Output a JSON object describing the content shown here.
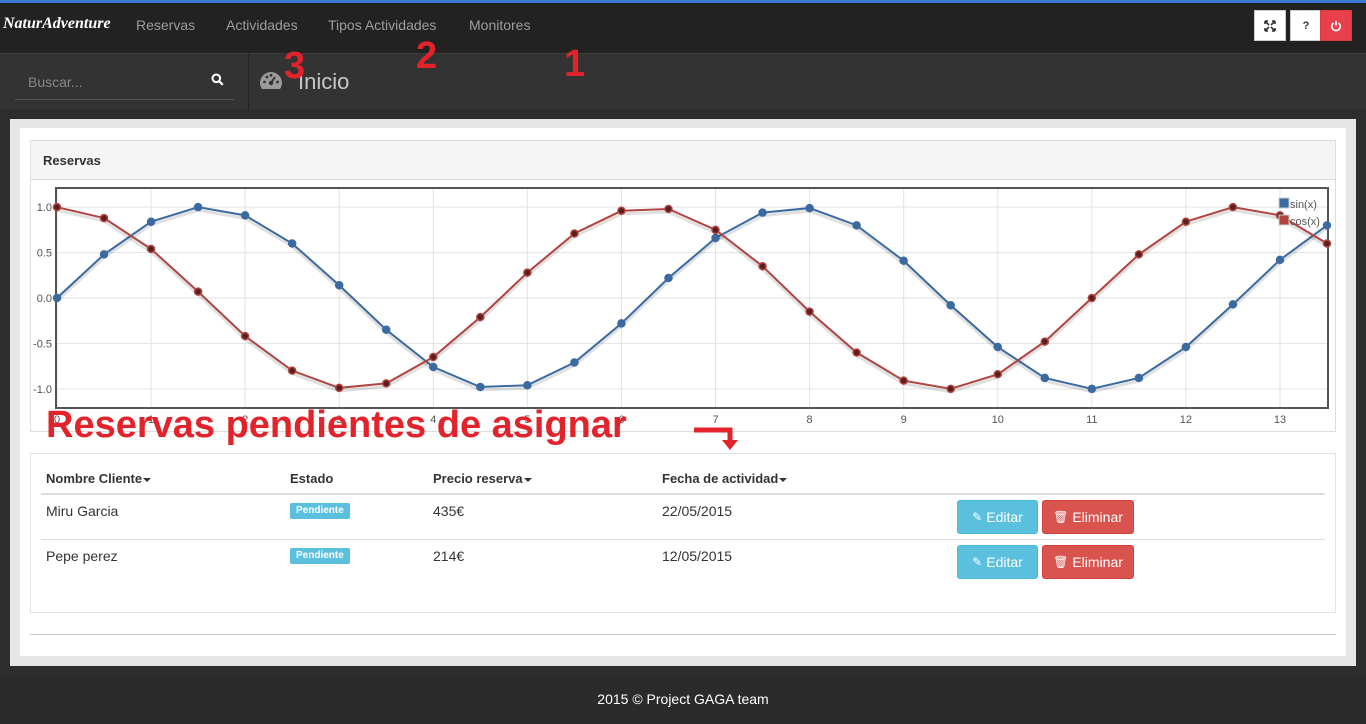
{
  "app": {
    "brand": "NaturAdventure",
    "nav": [
      "Reservas",
      "Actividades",
      "Tipos Actividades",
      "Monitores"
    ],
    "toolbar_icons": [
      "fullscreen-icon",
      "help-icon",
      "power-icon"
    ],
    "help_label": "?"
  },
  "search": {
    "placeholder": "Buscar..."
  },
  "page": {
    "title": "Inicio"
  },
  "annotations": {
    "n1": "1",
    "n2": "2",
    "n3": "3",
    "banner": "Reservas pendientes de asignar"
  },
  "panel": {
    "title": "Reservas"
  },
  "chart_data": {
    "type": "line",
    "x": [
      0,
      0.5,
      1,
      1.5,
      2,
      2.5,
      3,
      3.5,
      4,
      4.5,
      5,
      5.5,
      6,
      6.5,
      7,
      7.5,
      8,
      8.5,
      9,
      9.5,
      10,
      10.5,
      11,
      11.5,
      12,
      12.5,
      13,
      13.5
    ],
    "series": [
      {
        "name": "sin(x)",
        "color": "#3b6aa0",
        "values": [
          0,
          0.48,
          0.84,
          1.0,
          0.91,
          0.6,
          0.14,
          -0.35,
          -0.76,
          -0.98,
          -0.96,
          -0.71,
          -0.28,
          0.22,
          0.66,
          0.94,
          0.99,
          0.8,
          0.41,
          -0.08,
          -0.54,
          -0.88,
          -1.0,
          -0.88,
          -0.54,
          -0.07,
          0.42,
          0.8
        ]
      },
      {
        "name": "cos(x)",
        "color": "#b04440",
        "values": [
          1.0,
          0.88,
          0.54,
          0.07,
          -0.42,
          -0.8,
          -0.99,
          -0.94,
          -0.65,
          -0.21,
          0.28,
          0.71,
          0.96,
          0.98,
          0.75,
          0.35,
          -0.15,
          -0.6,
          -0.91,
          -1.0,
          -0.84,
          -0.48,
          0.0,
          0.48,
          0.84,
          1.0,
          0.91,
          0.6
        ]
      }
    ],
    "xticks": [
      "0",
      "1",
      "2",
      "3",
      "4",
      "5",
      "6",
      "7",
      "8",
      "9",
      "10",
      "11",
      "12",
      "13"
    ],
    "yticks": [
      "1.0",
      "0.5",
      "0.0",
      "-0.5",
      "-1.0"
    ],
    "xlim": [
      0,
      13.5
    ],
    "ylim": [
      -1.2,
      1.2
    ],
    "grid": true,
    "legend_position": "top-right"
  },
  "table": {
    "headers": [
      "Nombre Cliente",
      "Estado",
      "Precio reserva",
      "Fecha de actividad"
    ],
    "rows": [
      {
        "name": "Miru Garcia",
        "status": "Pendiente",
        "price": "435€",
        "date": "22/05/2015"
      },
      {
        "name": "Pepe perez",
        "status": "Pendiente",
        "price": "214€",
        "date": "12/05/2015"
      }
    ],
    "edit_label": "Editar",
    "delete_label": "Eliminar"
  },
  "footer": {
    "text": "2015 © Project GAGA team"
  }
}
